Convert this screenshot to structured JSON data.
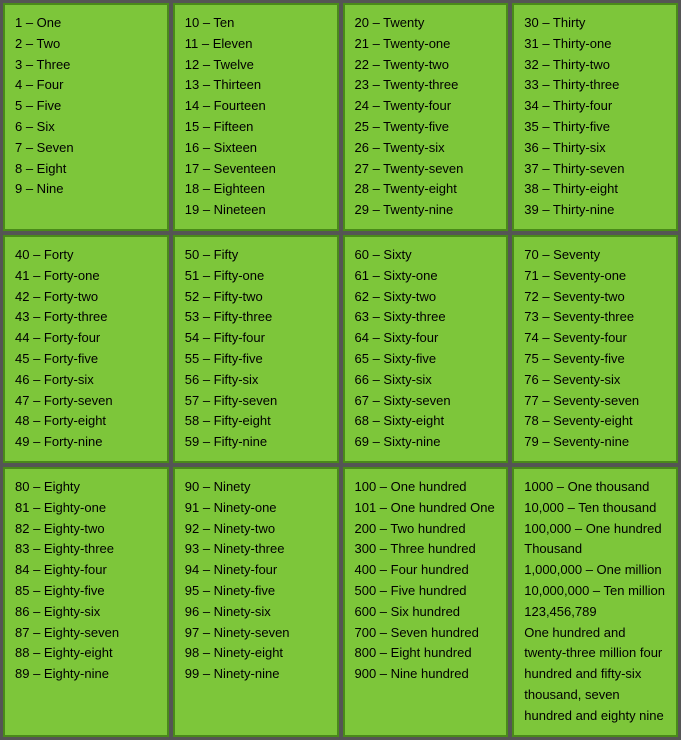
{
  "cells": [
    {
      "id": "cell-1-9",
      "lines": [
        "1 – One",
        "2 – Two",
        "3 – Three",
        "4 – Four",
        "5 – Five",
        "6 – Six",
        "7 – Seven",
        "8 – Eight",
        "9 – Nine"
      ]
    },
    {
      "id": "cell-10-19",
      "lines": [
        "10 – Ten",
        "11 – Eleven",
        "12 – Twelve",
        "13 – Thirteen",
        "14 – Fourteen",
        "15 – Fifteen",
        "16 – Sixteen",
        "17 – Seventeen",
        "18 – Eighteen",
        "19 – Nineteen"
      ]
    },
    {
      "id": "cell-20-29",
      "lines": [
        "20 – Twenty",
        "21 – Twenty-one",
        "22 – Twenty-two",
        "23 – Twenty-three",
        "24 – Twenty-four",
        "25 – Twenty-five",
        "26 – Twenty-six",
        "27 – Twenty-seven",
        "28 – Twenty-eight",
        "29 – Twenty-nine"
      ]
    },
    {
      "id": "cell-30-39",
      "lines": [
        "30 – Thirty",
        "31 – Thirty-one",
        "32 – Thirty-two",
        "33 – Thirty-three",
        "34 – Thirty-four",
        "35 – Thirty-five",
        "36 – Thirty-six",
        "37 – Thirty-seven",
        "38 – Thirty-eight",
        "39 – Thirty-nine"
      ]
    },
    {
      "id": "cell-40-49",
      "lines": [
        "40 – Forty",
        "41 – Forty-one",
        "42 – Forty-two",
        "43 – Forty-three",
        "44 – Forty-four",
        "45 – Forty-five",
        "46 – Forty-six",
        "47 – Forty-seven",
        "48 – Forty-eight",
        "49 – Forty-nine"
      ]
    },
    {
      "id": "cell-50-59",
      "lines": [
        "50 – Fifty",
        "51 – Fifty-one",
        "52 – Fifty-two",
        "53 – Fifty-three",
        "54 – Fifty-four",
        "55 – Fifty-five",
        "56 – Fifty-six",
        "57 – Fifty-seven",
        "58 – Fifty-eight",
        "59 – Fifty-nine"
      ]
    },
    {
      "id": "cell-60-69",
      "lines": [
        "60 – Sixty",
        "61 – Sixty-one",
        "62 – Sixty-two",
        "63 – Sixty-three",
        "64 – Sixty-four",
        "65 – Sixty-five",
        "66 – Sixty-six",
        "67 – Sixty-seven",
        "68 – Sixty-eight",
        "69 – Sixty-nine"
      ]
    },
    {
      "id": "cell-70-79",
      "lines": [
        "70 – Seventy",
        "71 – Seventy-one",
        "72 – Seventy-two",
        "73 – Seventy-three",
        "74 – Seventy-four",
        "75 – Seventy-five",
        "76 – Seventy-six",
        "77 – Seventy-seven",
        "78 – Seventy-eight",
        "79 – Seventy-nine"
      ]
    },
    {
      "id": "cell-80-89",
      "lines": [
        "80 – Eighty",
        "81 – Eighty-one",
        "82 – Eighty-two",
        "83 – Eighty-three",
        "84 – Eighty-four",
        "85 – Eighty-five",
        "86 – Eighty-six",
        "87 – Eighty-seven",
        "88 – Eighty-eight",
        "89 – Eighty-nine"
      ]
    },
    {
      "id": "cell-90-99",
      "lines": [
        "90 – Ninety",
        "91 – Ninety-one",
        "92 – Ninety-two",
        "93 – Ninety-three",
        "94 – Ninety-four",
        "95 – Ninety-five",
        "96 – Ninety-six",
        "97 – Ninety-seven",
        "98 – Ninety-eight",
        "99 – Ninety-nine"
      ]
    },
    {
      "id": "cell-100-900",
      "lines": [
        "100 – One hundred",
        "101 – One hundred One",
        "200 – Two hundred",
        "300 – Three hundred",
        "400 – Four hundred",
        "500 – Five hundred",
        "600 – Six hundred",
        "700 – Seven hundred",
        "800 – Eight hundred",
        "900 – Nine hundred"
      ]
    },
    {
      "id": "cell-1000-plus",
      "lines": [
        "1000 – One thousand",
        "10,000 – Ten thousand",
        "100,000 – One hundred Thousand",
        "1,000,000 – One million",
        "10,000,000 – Ten million",
        "    123,456,789",
        "One hundred and twenty-three million four hundred and fifty-six thousand, seven hundred and eighty nine"
      ]
    }
  ]
}
